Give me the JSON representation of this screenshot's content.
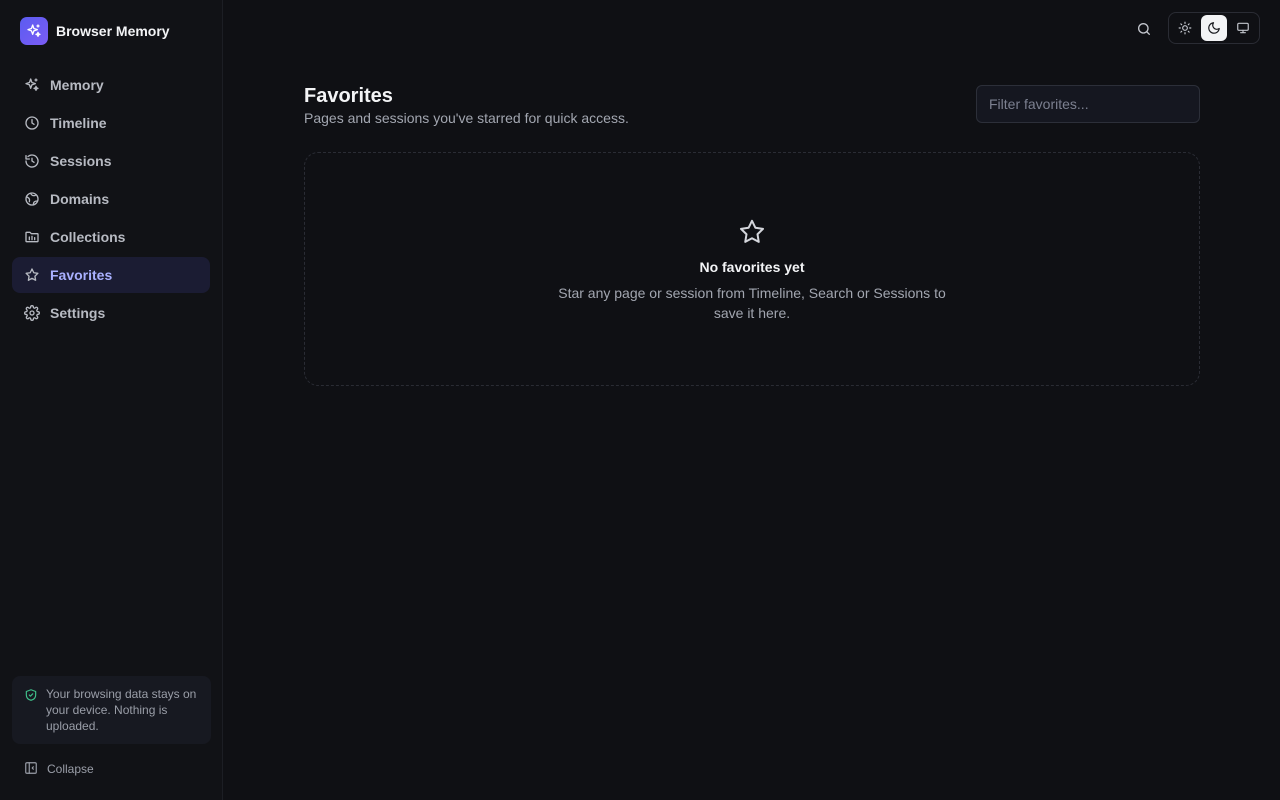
{
  "app": {
    "name": "Browser Memory"
  },
  "sidebar": {
    "items": [
      {
        "label": "Memory",
        "icon": "sparkle-icon",
        "active": false
      },
      {
        "label": "Timeline",
        "icon": "clock-icon",
        "active": false
      },
      {
        "label": "Sessions",
        "icon": "history-icon",
        "active": false
      },
      {
        "label": "Domains",
        "icon": "globe-icon",
        "active": false
      },
      {
        "label": "Collections",
        "icon": "folder-icon",
        "active": false
      },
      {
        "label": "Favorites",
        "icon": "star-icon",
        "active": true
      },
      {
        "label": "Settings",
        "icon": "gear-icon",
        "active": false
      }
    ],
    "privacy_note": "Your browsing data stays on your device. Nothing is uploaded.",
    "collapse_label": "Collapse"
  },
  "topbar": {
    "theme_options": [
      "light",
      "dark",
      "system"
    ],
    "active_theme": "dark"
  },
  "page": {
    "title": "Favorites",
    "subtitle": "Pages and sessions you've starred for quick access.",
    "filter_placeholder": "Filter favorites...",
    "filter_value": ""
  },
  "empty_state": {
    "title": "No favorites yet",
    "description": "Star any page or session from Timeline, Search or Sessions to save it here."
  },
  "colors": {
    "background": "#0f1014",
    "sidebar": "#111216",
    "accent": "#5b5cf0",
    "active_nav_bg": "#1b1c33",
    "active_nav_text": "#a9b0ff",
    "privacy_icon": "#3fbf8a"
  }
}
